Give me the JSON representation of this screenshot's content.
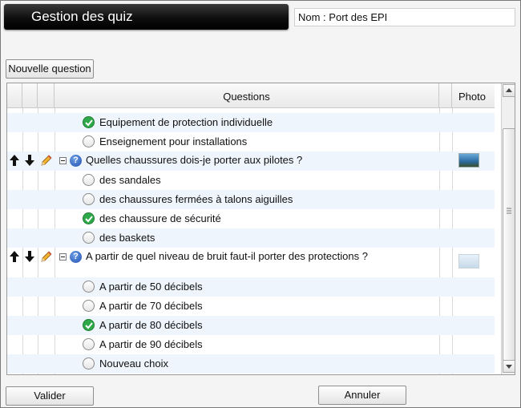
{
  "window": {
    "title": "Gestion des quiz"
  },
  "quiz": {
    "name_label": "Nom :",
    "name_value": "Port des EPI"
  },
  "toolbar": {
    "new_question_label": "Nouvelle question"
  },
  "table": {
    "headers": {
      "questions": "Questions",
      "photo": "Photo"
    },
    "rows": [
      {
        "type": "answer",
        "text": "Equipement de protection individuelle",
        "correct": true
      },
      {
        "type": "answer",
        "text": "Enseignement pour installations",
        "correct": false
      },
      {
        "type": "question",
        "text": "Quelles chaussures dois-je porter aux pilotes ?",
        "has_photo": true
      },
      {
        "type": "answer",
        "text": "des sandales",
        "correct": false
      },
      {
        "type": "answer",
        "text": "des chaussures fermées à talons aiguilles",
        "correct": false
      },
      {
        "type": "answer",
        "text": "des chaussure de sécurité",
        "correct": true
      },
      {
        "type": "answer",
        "text": "des baskets",
        "correct": false
      },
      {
        "type": "question",
        "text": "A partir de quel niveau de bruit faut-il porter des protections ?",
        "has_photo": false
      },
      {
        "type": "answer",
        "text": "A partir de 50 décibels",
        "correct": false
      },
      {
        "type": "answer",
        "text": "A partir de 70 décibels",
        "correct": false
      },
      {
        "type": "answer",
        "text": "A partir de 80 décibels",
        "correct": true
      },
      {
        "type": "answer",
        "text": "A partir de 90 décibels",
        "correct": false
      },
      {
        "type": "answer",
        "text": "Nouveau choix",
        "correct": false
      }
    ]
  },
  "footer": {
    "validate_label": "Valider",
    "cancel_label": "Annuler"
  },
  "icons": {
    "move_up": "arrow-up-icon",
    "move_down": "arrow-down-icon",
    "edit": "pencil-icon",
    "question": "question-icon",
    "collapse": "collapse-icon",
    "correct": "check-icon",
    "choice": "radio-icon",
    "photo": "photo-thumbnail"
  },
  "colors": {
    "title_bar": "#000000",
    "row_alt": "#eef5fc",
    "check": "#2fa84a",
    "question_icon": "#2a5cc0"
  }
}
